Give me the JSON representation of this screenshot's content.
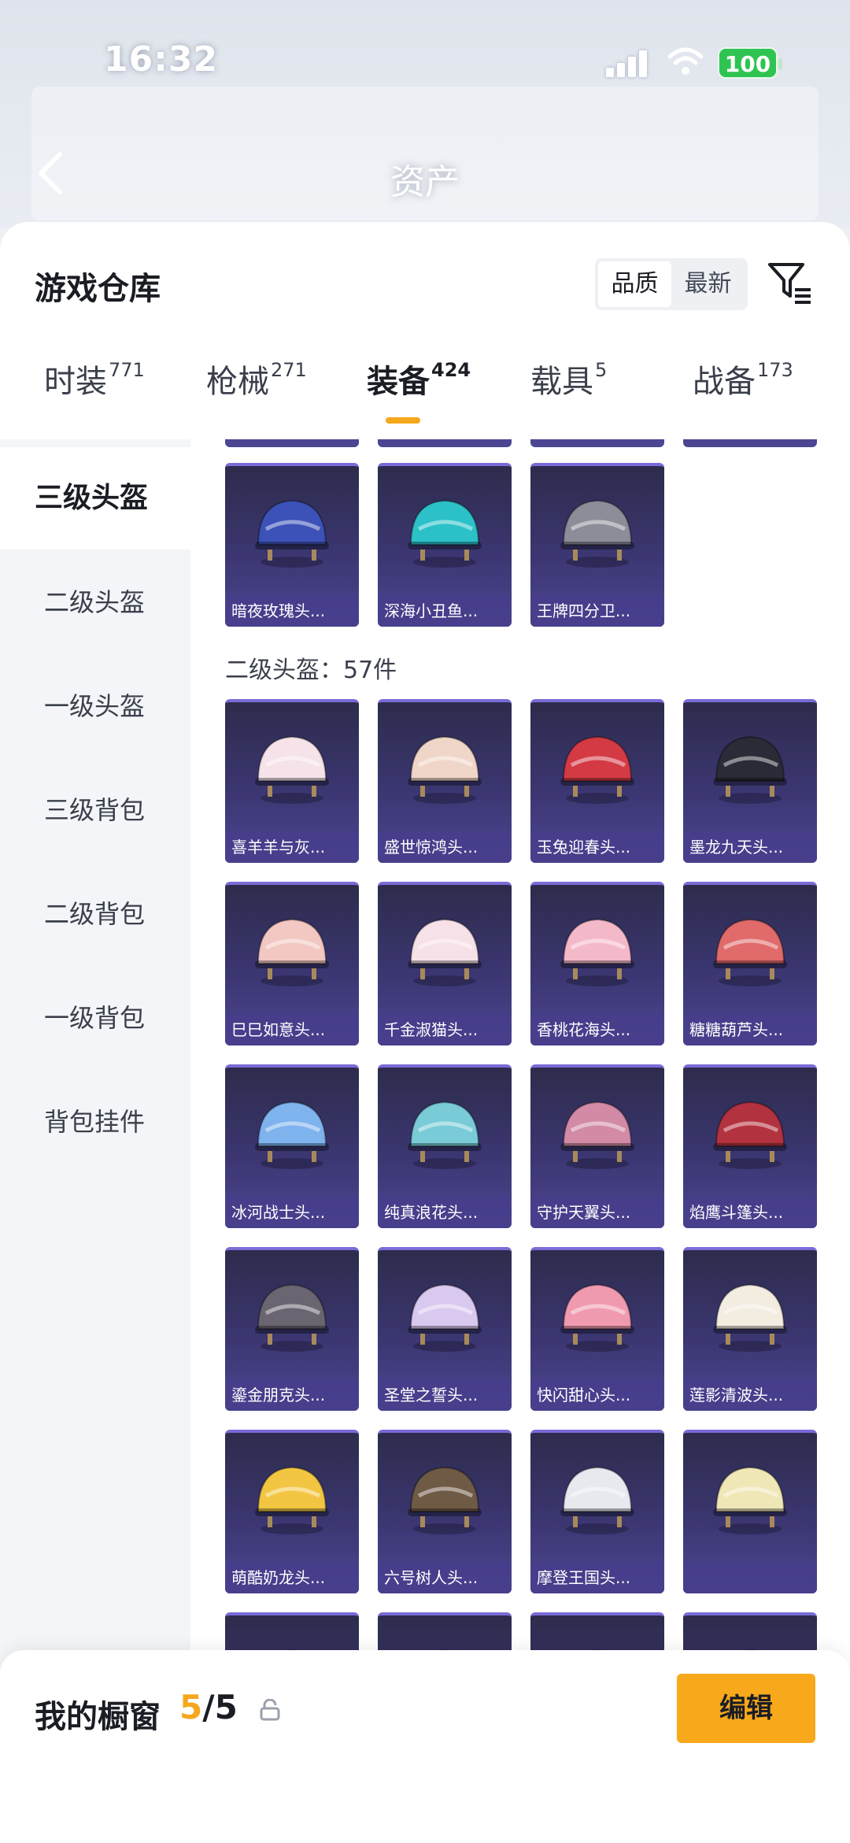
{
  "status_bar": {
    "time": "16:32",
    "battery": "100"
  },
  "nav": {
    "title": "资产"
  },
  "header": {
    "title": "游戏仓库",
    "sort_options": [
      "品质",
      "最新"
    ],
    "active_sort": 0
  },
  "tabs": [
    {
      "label": "时装",
      "count": "771"
    },
    {
      "label": "枪械",
      "count": "271"
    },
    {
      "label": "装备",
      "count": "424",
      "active": true
    },
    {
      "label": "载具",
      "count": "5"
    },
    {
      "label": "战备",
      "count": "173"
    }
  ],
  "sidebar": {
    "items": [
      {
        "label": "三级头盔",
        "active": true
      },
      {
        "label": "二级头盔"
      },
      {
        "label": "一级头盔"
      },
      {
        "label": "三级背包"
      },
      {
        "label": "二级背包"
      },
      {
        "label": "一级背包"
      },
      {
        "label": "背包挂件"
      }
    ]
  },
  "grid": {
    "level3_items": [
      {
        "name": "暗夜玫瑰头...",
        "icon": "helmet-icon",
        "color": "#3c52b8"
      },
      {
        "name": "深海小丑鱼...",
        "icon": "helmet-icon",
        "color": "#2cc1c9"
      },
      {
        "name": "王牌四分卫...",
        "icon": "helmet-icon",
        "color": "#8d8d9a"
      }
    ],
    "section_label": "二级头盔：57件",
    "level2_items": [
      {
        "name": "喜羊羊与灰...",
        "icon": "helmet-icon",
        "color": "#f6e3ea"
      },
      {
        "name": "盛世惊鸿头...",
        "icon": "helmet-icon",
        "color": "#f0d6c8"
      },
      {
        "name": "玉兔迎春头...",
        "icon": "helmet-icon",
        "color": "#d43a44"
      },
      {
        "name": "墨龙九天头...",
        "icon": "helmet-icon",
        "color": "#2a2b36"
      },
      {
        "name": "巳巳如意头...",
        "icon": "helmet-icon",
        "color": "#f3c8c2"
      },
      {
        "name": "千金淑猫头...",
        "icon": "helmet-icon",
        "color": "#f6e1e8"
      },
      {
        "name": "香桃花海头...",
        "icon": "helmet-icon",
        "color": "#f4b9c9"
      },
      {
        "name": "糖糖葫芦头...",
        "icon": "helmet-icon",
        "color": "#e16a6a"
      },
      {
        "name": "冰河战士头...",
        "icon": "helmet-icon",
        "color": "#7fb3ee"
      },
      {
        "name": "纯真浪花头...",
        "icon": "helmet-icon",
        "color": "#79cbd8"
      },
      {
        "name": "守护天翼头...",
        "icon": "helmet-icon",
        "color": "#d28aa6"
      },
      {
        "name": "焰鹰斗篷头...",
        "icon": "helmet-icon",
        "color": "#b3323f"
      },
      {
        "name": "鎏金朋克头...",
        "icon": "helmet-icon",
        "color": "#6a6570"
      },
      {
        "name": "圣堂之誓头...",
        "icon": "helmet-icon",
        "color": "#d9c9ef"
      },
      {
        "name": "快闪甜心头...",
        "icon": "helmet-icon",
        "color": "#f09ab0"
      },
      {
        "name": "莲影清波头...",
        "icon": "helmet-icon",
        "color": "#f3ece0"
      },
      {
        "name": "萌酷奶龙头...",
        "icon": "helmet-icon",
        "color": "#f2c643"
      },
      {
        "name": "六号树人头...",
        "icon": "helmet-icon",
        "color": "#6f5a45"
      },
      {
        "name": "摩登王国头...",
        "icon": "helmet-icon",
        "color": "#e7e9ef"
      },
      {
        "name": "",
        "icon": "helmet-icon",
        "color": "#efe7b6"
      }
    ]
  },
  "bottom": {
    "title": "我的橱窗",
    "current": "5",
    "total": "/5",
    "edit_label": "编辑"
  },
  "colors": {
    "accent": "#f5a81c",
    "card_bg": "#3b3671"
  }
}
